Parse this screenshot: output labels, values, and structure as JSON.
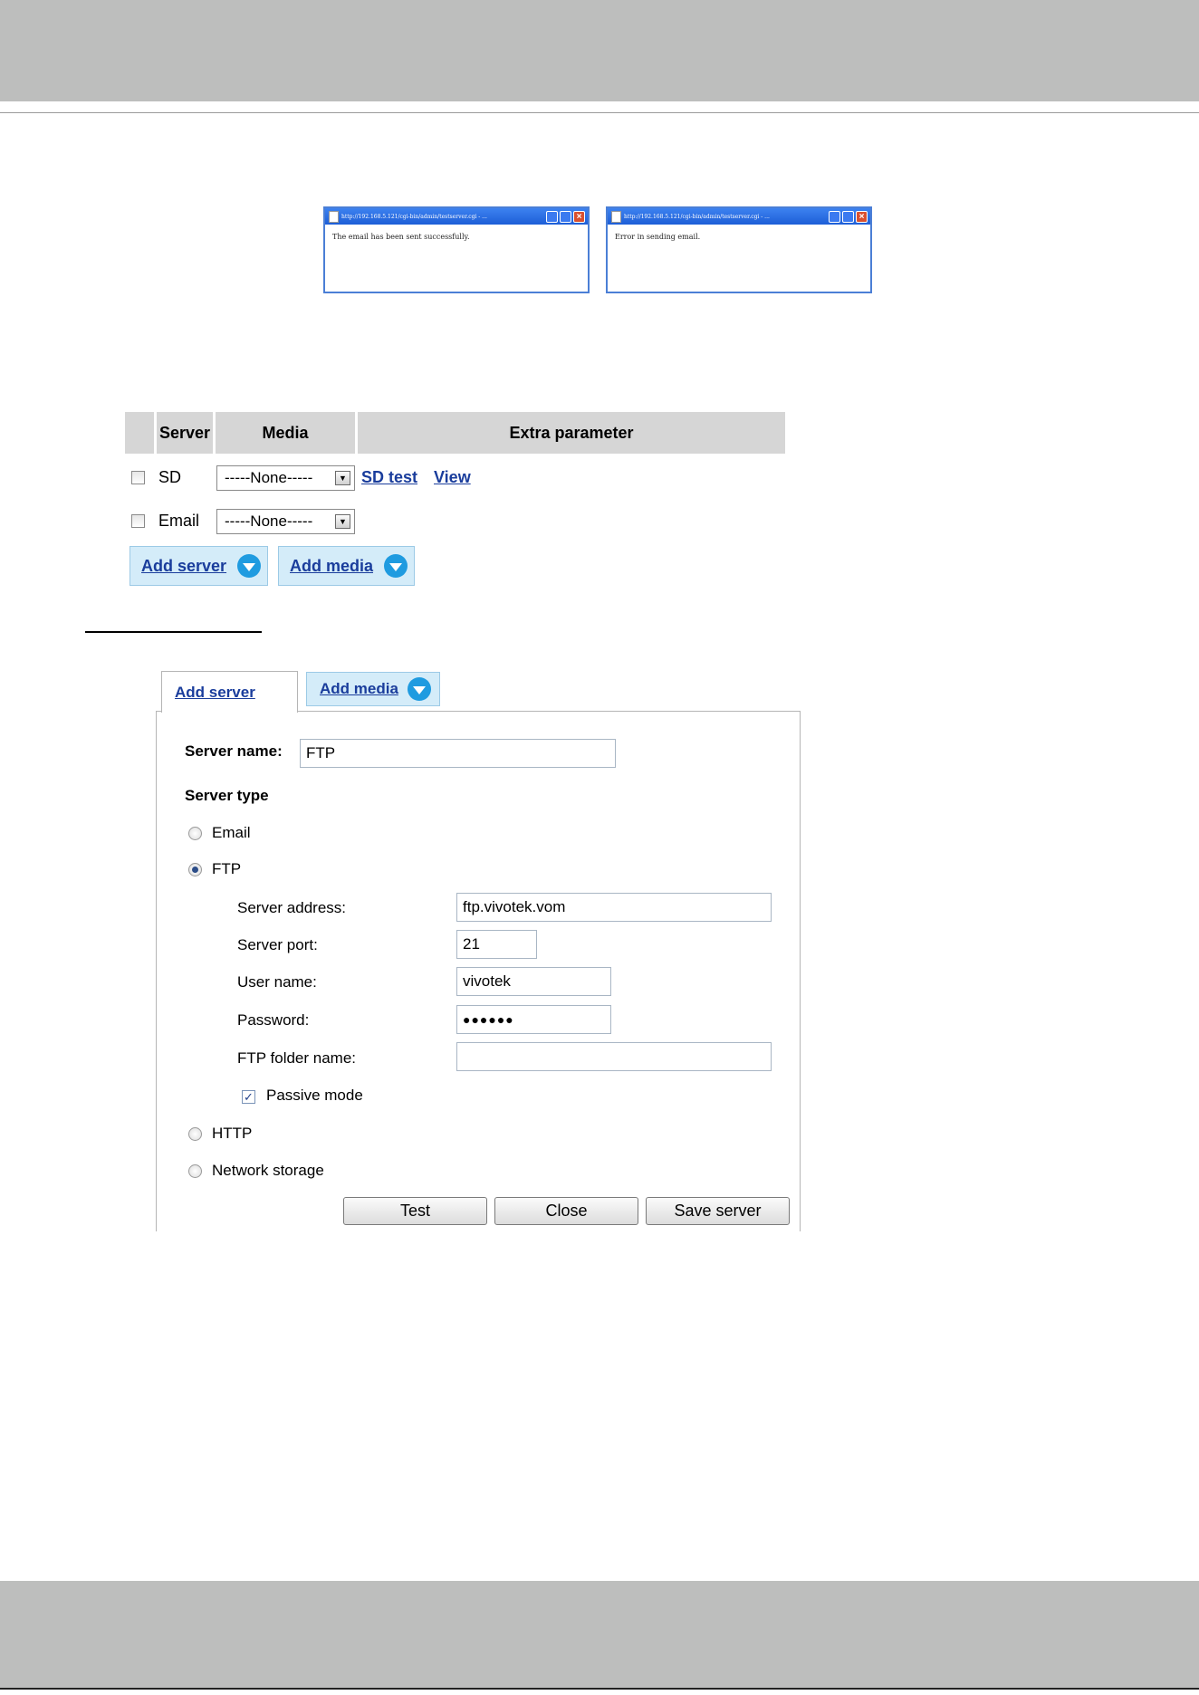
{
  "popups": {
    "success": {
      "title": "http://192.168.5.121/cgi-bin/admin/testserver.cgi - ...",
      "message": "The email has been sent successfully."
    },
    "error": {
      "title": "http://192.168.5.121/cgi-bin/admin/testserver.cgi - ...",
      "message": "Error in sending email."
    }
  },
  "table": {
    "headers": [
      "Server",
      "Media",
      "Extra parameter"
    ],
    "rows": [
      {
        "server": "SD",
        "media": "-----None-----",
        "links": [
          "SD test",
          "View"
        ]
      },
      {
        "server": "Email",
        "media": "-----None-----"
      }
    ],
    "add_server_label": "Add server",
    "add_media_label": "Add media"
  },
  "panel": {
    "tabs": {
      "add_server": "Add server",
      "add_media": "Add media"
    },
    "server_name_label": "Server name:",
    "server_name_value": "FTP",
    "server_type_label": "Server type",
    "types": [
      "Email",
      "FTP",
      "HTTP",
      "Network storage"
    ],
    "selected_type": "FTP",
    "ftp": {
      "server_address_label": "Server address:",
      "server_address_value": "ftp.vivotek.vom",
      "server_port_label": "Server port:",
      "server_port_value": "21",
      "user_name_label": "User name:",
      "user_name_value": "vivotek",
      "password_label": "Password:",
      "password_value": "●●●●●●",
      "folder_label": "FTP folder name:",
      "folder_value": "",
      "passive_label": "Passive mode",
      "passive_checked": true
    },
    "buttons": {
      "test": "Test",
      "close": "Close",
      "save": "Save server"
    }
  },
  "colors": {
    "band": "#bdbebd",
    "tab_blue": "#d4ecf9",
    "icon_blue": "#1f9be0",
    "link": "#1a3d9c"
  }
}
